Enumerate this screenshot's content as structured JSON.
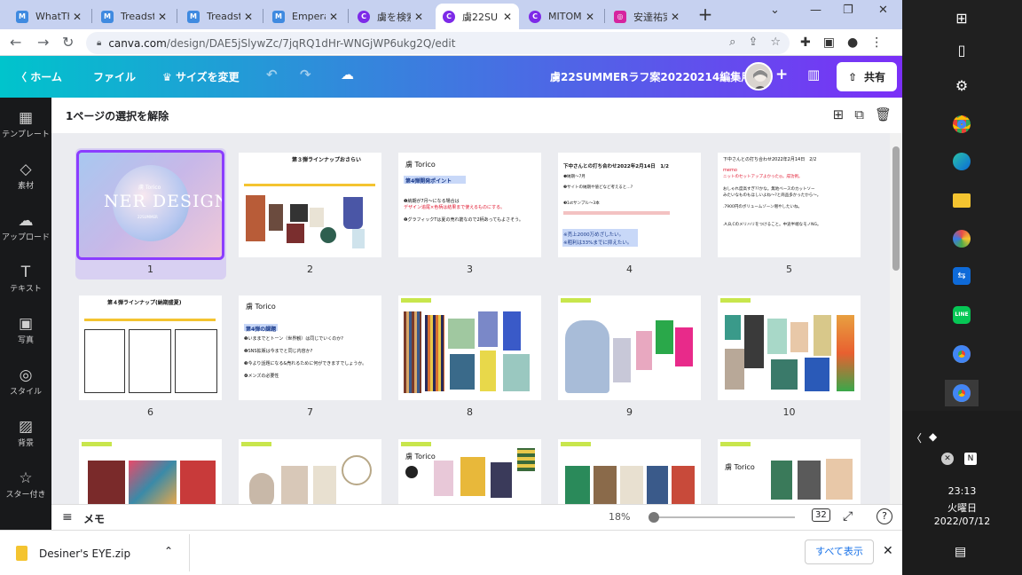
{
  "browser": {
    "tabs": [
      {
        "label": "WhatTh",
        "fav_color": "#3f8ae0",
        "fav_text": "M"
      },
      {
        "label": "Treadsto",
        "fav_color": "#3f8ae0",
        "fav_text": "M"
      },
      {
        "label": "Treadsto",
        "fav_color": "#3f8ae0",
        "fav_text": "M"
      },
      {
        "label": "Empera",
        "fav_color": "#3f8ae0",
        "fav_text": "M"
      },
      {
        "label": "虜を検索",
        "fav_color": "#7d2ae8",
        "fav_text": "C"
      },
      {
        "label": "虜22SU",
        "fav_color": "#7d2ae8",
        "fav_text": "C"
      },
      {
        "label": "MITOMI",
        "fav_color": "#7d2ae8",
        "fav_text": "C"
      },
      {
        "label": "安達祐実",
        "fav_color": "#d6249f",
        "fav_text": "◎"
      }
    ],
    "new_tab": "+",
    "url_main": "canva.com",
    "url_rest": "/design/DAE5jSlywZc/7jqRQ1dHr-WNGjWP6ukg2Q/edit"
  },
  "canva": {
    "home": "ホーム",
    "file": "ファイル",
    "resize": "サイズを変更",
    "doc_title": "虜22SUMMERラフ案20220214編集用",
    "share": "共有",
    "deselect": "1ページの選択を解除",
    "sidebar": [
      {
        "icon": "▦",
        "label": "テンプレート"
      },
      {
        "icon": "◇",
        "label": "素材"
      },
      {
        "icon": "☁",
        "label": "アップロード"
      },
      {
        "icon": "T",
        "label": "テキスト"
      },
      {
        "icon": "▣",
        "label": "写真"
      },
      {
        "icon": "◎",
        "label": "スタイル"
      },
      {
        "icon": "▨",
        "label": "背景"
      },
      {
        "icon": "☆",
        "label": "スター付き"
      }
    ],
    "pages": [
      {
        "num": "1"
      },
      {
        "num": "2"
      },
      {
        "num": "3"
      },
      {
        "num": "4"
      },
      {
        "num": "5"
      },
      {
        "num": "6"
      },
      {
        "num": "7"
      },
      {
        "num": "8"
      },
      {
        "num": "9"
      },
      {
        "num": "10"
      }
    ],
    "thumb_text": {
      "p1_brand": "虜 Torico",
      "p1_title": "NER DESIGN",
      "p1_sub": "22SUMMER",
      "p2_title": "第３弾ラインナップおさらい",
      "p3_brand": "虜 Torico",
      "p3_head": "第4弾開発ポイント",
      "p3_line1": "❶納期が7月〜になる場合は",
      "p3_line2": "デザイン追尾×色柄は結果まで使えるものにする。",
      "p3_line3": "❷グラフィックTは夏の売れ筋なので2柄あってもよさそう。",
      "p4_title": "下中さんとの打ち合わせ2022年2月14日　1/2",
      "p4_l1": "❶納期〜7月",
      "p4_l2": "❷サイトの納期や値どなど考えると…?",
      "p4_l3": "❸1stサンプル〜3本",
      "p4_l4": "※売上2000万めざしたい。",
      "p4_l5": "※粗利は33%までに抑えたい。",
      "p5_title": "下中さんとの打ち合わせ2022年2月14日　2/2",
      "p5_memo": "memo",
      "p5_l1": "ニットのセットアップよかった◎。成功例。",
      "p5_l2": "おしゃれ度高すぎ??かな。無地ベースのカットソー",
      "p5_l3": "みたいなものもほしいよね〜?と商品多かったから〜。",
      "p5_l4": ".7900円のボリュームゾーン増やしたいね。",
      "p5_l5": ".A,B,Cのメリハリをつけること。中途半端なモノNG。",
      "p6_title": "第４弾ラインナップ(納期盛夏)",
      "p7_brand": "虜 Torico",
      "p7_head": "第4弾の課題",
      "p7_l1": "❶いままでとトーン（世界観）は同じでいくのか?",
      "p7_l2": "❷SNS拡販は今までと同じ内容か?",
      "p7_l3": "❸今より話題になる&売れるために何ができますでしょうか。",
      "p7_l4": "❹メンズの必要性",
      "p13_brand": "虜 Torico",
      "p15_brand": "虜 Torico"
    },
    "zoom": "18%",
    "memo": "メモ",
    "page_count": "32"
  },
  "download": {
    "file": "Desiner's EYE.zip",
    "show_all": "すべて表示"
  },
  "taskbar": {
    "time": "23:13",
    "weekday": "火曜日",
    "date": "2022/07/12"
  }
}
